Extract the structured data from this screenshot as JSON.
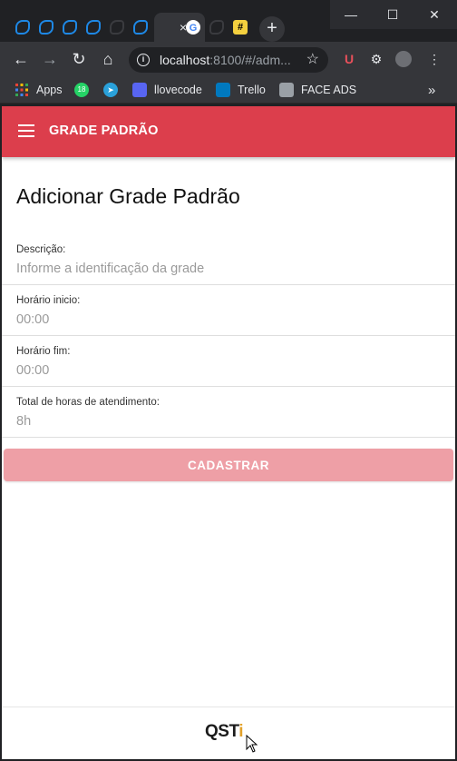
{
  "browser": {
    "tabs": [
      {
        "name": "tab-1",
        "icon": "app-icon",
        "color": "#1e88e5"
      },
      {
        "name": "tab-2",
        "icon": "app-icon",
        "color": "#1e88e5"
      },
      {
        "name": "tab-3",
        "icon": "app-icon",
        "color": "#1e88e5"
      },
      {
        "name": "tab-4",
        "icon": "app-icon",
        "color": "#1e88e5"
      },
      {
        "name": "tab-5",
        "icon": "app-icon",
        "color": "#2b2c30"
      },
      {
        "name": "tab-6",
        "icon": "app-icon",
        "color": "#1e88e5"
      }
    ],
    "active_tab_close": "×",
    "google_tab_icon": "google-icon",
    "new_tab_label": "+",
    "window_controls": {
      "minimize": "—",
      "maximize": "☐",
      "close": "✕"
    },
    "address": {
      "host": "localhost",
      "rest": ":8100/#/adm..."
    },
    "bookmarks": [
      {
        "label": "Apps",
        "icon": "apps-grid-icon"
      },
      {
        "label": "",
        "icon": "whatsapp-icon"
      },
      {
        "label": "",
        "icon": "telegram-icon"
      },
      {
        "label": "llovecode",
        "icon": "discord-icon"
      },
      {
        "label": "Trello",
        "icon": "trello-icon"
      },
      {
        "label": "FACE ADS",
        "icon": "folder-icon"
      }
    ],
    "bookmarks_overflow": "»",
    "whatsapp_badge": "18"
  },
  "app": {
    "header_title": "GRADE PADRÃO",
    "page_title": "Adicionar Grade Padrão",
    "fields": [
      {
        "label": "Descrição:",
        "placeholder": "Informe a identificação da grade",
        "value": ""
      },
      {
        "label": "Horário inicio:",
        "placeholder": "00:00",
        "value": ""
      },
      {
        "label": "Horário fim:",
        "placeholder": "00:00",
        "value": ""
      },
      {
        "label": "Total de horas de atendimento:",
        "placeholder": "8h",
        "value": ""
      }
    ],
    "submit_label": "CADASTRAR",
    "footer_logo": {
      "main": "QST",
      "accent": "i"
    },
    "colors": {
      "primary": "#dc3e4c",
      "button_disabled": "#ee9fa6"
    }
  }
}
